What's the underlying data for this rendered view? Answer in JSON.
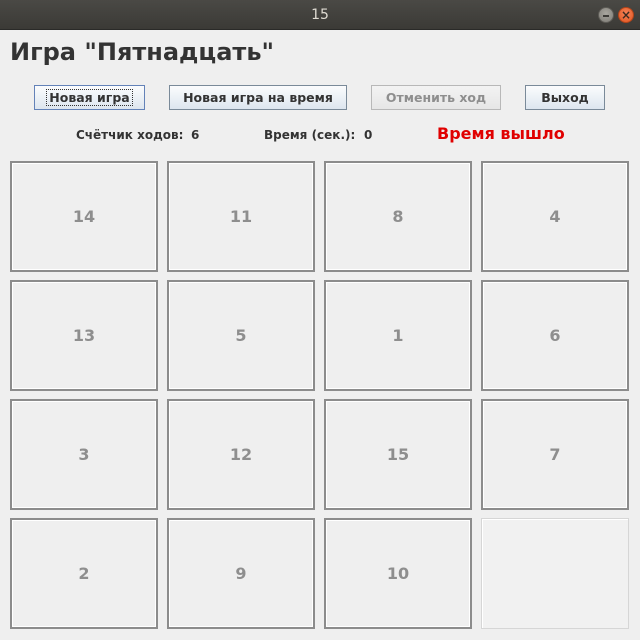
{
  "window": {
    "title": "15",
    "close_symbol": "×"
  },
  "heading": "Игра \"Пятнадцать\"",
  "buttons": {
    "new_game": "Новая игра",
    "new_timed_game": "Новая игра на время",
    "undo_move": "Отменить ход",
    "exit": "Выход"
  },
  "status": {
    "moves_label": "Счётчик ходов:",
    "moves_value": "6",
    "time_label": "Время (сек.):",
    "time_value": "0",
    "time_up": "Время вышло",
    "time_up_color": "#e00000"
  },
  "board": {
    "tiles": [
      "14",
      "11",
      "8",
      "4",
      "13",
      "5",
      "1",
      "6",
      "3",
      "12",
      "15",
      "7",
      "2",
      "9",
      "10",
      ""
    ]
  }
}
